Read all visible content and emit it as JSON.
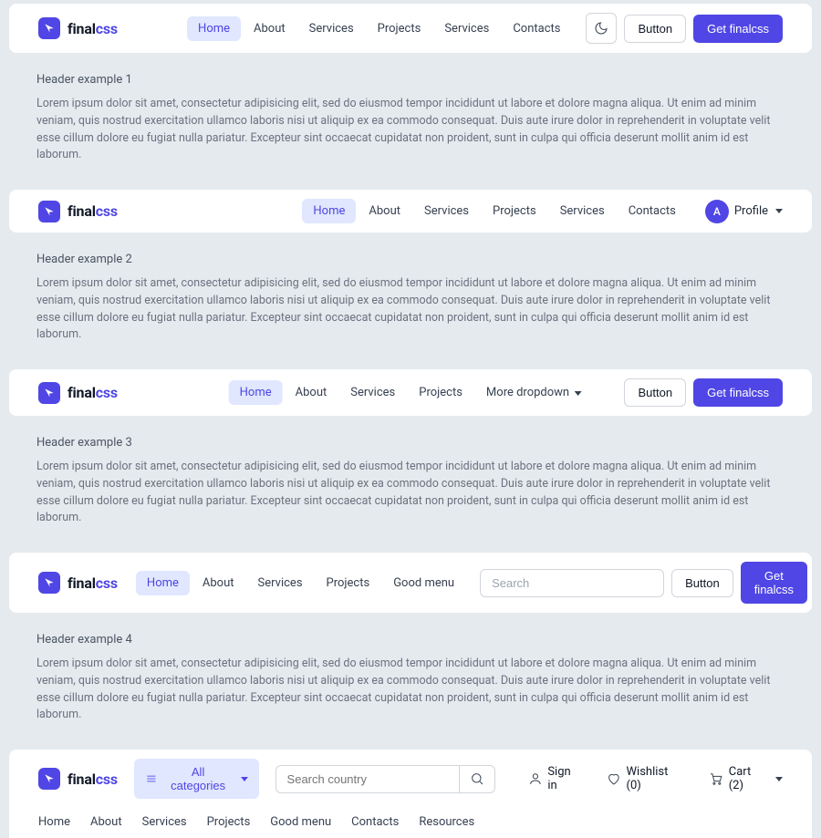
{
  "logo": {
    "bold": "final",
    "accent": "css"
  },
  "cta": {
    "button": "Button",
    "primary": "Get finalcss"
  },
  "lorem": "Lorem ipsum dolor sit amet, consectetur adipisicing elit, sed do eiusmod tempor incididunt ut labore et dolore magna aliqua. Ut enim ad minim veniam, quis nostrud exercitation ullamco laboris nisi ut aliquip ex ea commodo consequat. Duis aute irure dolor in reprehenderit in voluptate velit esse cillum dolore eu fugiat nulla pariatur. Excepteur sint occaecat cupidatat non proident, sunt in culpa qui officia deserunt mollit anim id est laborum.",
  "ex1": {
    "nav": {
      "home": "Home",
      "about": "About",
      "services": "Services",
      "projects": "Projects",
      "services2": "Services",
      "contacts": "Contacts"
    },
    "title": "Header example 1"
  },
  "ex2": {
    "nav": {
      "home": "Home",
      "about": "About",
      "services": "Services",
      "projects": "Projects",
      "services2": "Services",
      "contacts": "Contacts"
    },
    "avatar_initial": "A",
    "profile": "Profile",
    "title": "Header example 2"
  },
  "ex3": {
    "nav": {
      "home": "Home",
      "about": "About",
      "services": "Services",
      "projects": "Projects",
      "more": "More dropdown"
    },
    "title": "Header example 3"
  },
  "ex4": {
    "nav": {
      "home": "Home",
      "about": "About",
      "services": "Services",
      "projects": "Projects",
      "good": "Good menu"
    },
    "search_placeholder": "Search",
    "title": "Header example 4"
  },
  "ex5": {
    "categories": "All categories",
    "search_placeholder": "Search country",
    "signin": "Sign in",
    "wishlist": "Wishlist (0)",
    "cart": "Cart (2)",
    "subnav": {
      "home": "Home",
      "about": "About",
      "services": "Services",
      "projects": "Projects",
      "good": "Good menu",
      "contacts": "Contacts",
      "resources": "Resources"
    }
  }
}
